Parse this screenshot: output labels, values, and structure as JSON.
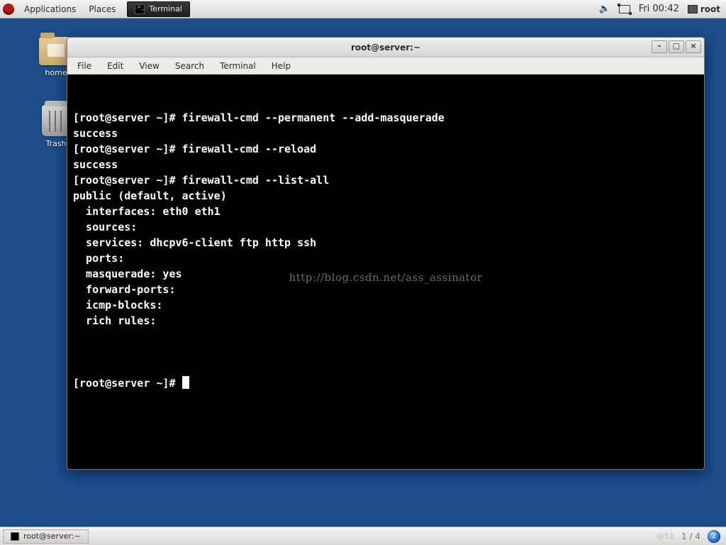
{
  "panel": {
    "applications": "Applications",
    "places": "Places",
    "task_terminal": "Terminal",
    "clock": "Fri 00:42",
    "user": "root"
  },
  "desktop": {
    "home_label": "home",
    "trash_label": "Trash"
  },
  "window": {
    "title": "root@server:~",
    "menu": {
      "file": "File",
      "edit": "Edit",
      "view": "View",
      "search": "Search",
      "terminal": "Terminal",
      "help": "Help"
    },
    "buttons": {
      "min": "–",
      "max": "▢",
      "close": "×"
    }
  },
  "terminal": {
    "lines": [
      "[root@server ~]# firewall-cmd --permanent --add-masquerade",
      "success",
      "[root@server ~]# firewall-cmd --reload",
      "success",
      "[root@server ~]# firewall-cmd --list-all",
      "public (default, active)",
      "  interfaces: eth0 eth1",
      "  sources: ",
      "  services: dhcpv6-client ftp http ssh",
      "  ports: ",
      "  masquerade: yes",
      "  forward-ports: ",
      "  icmp-blocks: ",
      "  rich rules: ",
      "\t"
    ],
    "prompt": "[root@server ~]# ",
    "watermark": "http://blog.csdn.net/ass_assinator"
  },
  "bottom": {
    "task": "root@server:~",
    "pager": "1 / 4",
    "faint": "@51",
    "workspace": "2"
  }
}
